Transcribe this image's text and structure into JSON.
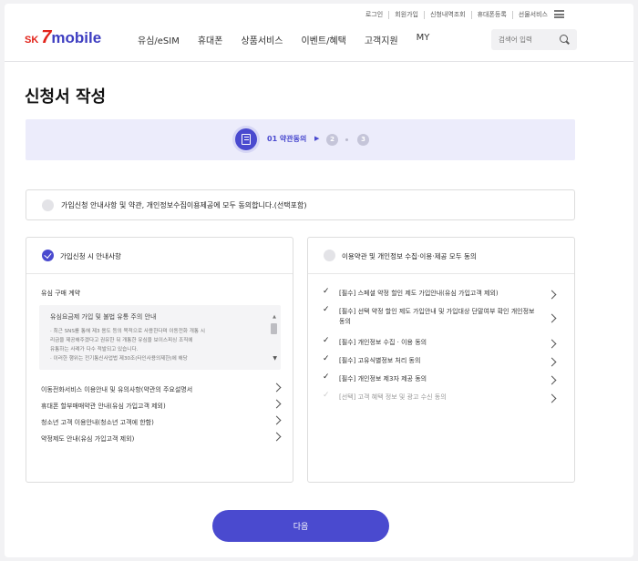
{
  "header": {
    "logo_sk": "SK",
    "logo_seven": "7",
    "logo_mobile": "mobile",
    "util_links": [
      "로그인",
      "회원가입",
      "신청내역조회",
      "휴대폰등록",
      "선물서비스"
    ],
    "nav": [
      "유심/eSIM",
      "휴대폰",
      "상품서비스",
      "이벤트/혜택",
      "고객지원",
      "MY"
    ],
    "search_placeholder": "검색어 입력"
  },
  "page_title": "신청서 작성",
  "stepper": {
    "current_label": "01 약관동의",
    "step2": "2",
    "step3": "3"
  },
  "all_agree": {
    "label": "가입신청 안내사항 및 약관, 개인정보수집이용제공에 모두 동의합니다.(선택포함)",
    "checked": false
  },
  "left_panel": {
    "header": "가입신청 시 안내사항",
    "checked": true,
    "section_title": "유심 구매 계약",
    "notice_title": "유심요금제 가입 및 불법 유통 주의 안내",
    "notice_lines": [
      "· 최근 SNS를 통해 제3 용도 등의 목적으로 사용한다며 이동전화 개통 시",
      "  리금을 제공해주겠다고 권유한 뒤 개통한 유심을 보이스피싱 조직에",
      "  유통하는 사례가 다수 적발되고 있습니다.",
      "· 이러한 행위는 전기통신사업법 제30조(타인사용의제한)에 해당"
    ],
    "items": [
      "이동전화서비스 이용안내 및 유의사항(약관의 주요설명서",
      "휴대폰 할부매매약관 안내(유심 가입고객 제외)",
      "청소년 고객 이용안내(청소년 고객에 한함)",
      "약정제도 안내(유심 가입고객 제외)"
    ]
  },
  "right_panel": {
    "header": "이용약관 및 개인정보 수집·이용·제공 모두 동의",
    "checked": false,
    "items": [
      {
        "text": "[필수] 스페셜 약정 할인 제도 가입안내(유심 가입고객 제외)",
        "checked": true
      },
      {
        "text": "[필수] 선택 약정 할인 제도 가입안내 및 가입대상 단말여부 확인 개인정보 동의",
        "checked": true
      },
      {
        "text": "[필수] 개인정보 수집 · 이용 동의",
        "checked": true
      },
      {
        "text": "[필수] 고유식별정보 처리 동의",
        "checked": true
      },
      {
        "text": "[필수] 개인정보 제3자 제공 동의",
        "checked": true
      },
      {
        "text": "[선택] 고객 혜택 정보 및 광고 수신 동의",
        "checked": false
      }
    ]
  },
  "next_button": "다음",
  "colors": {
    "accent": "#4a4acf",
    "brand_red": "#e2231a",
    "stepper_bg": "#ececfb"
  }
}
